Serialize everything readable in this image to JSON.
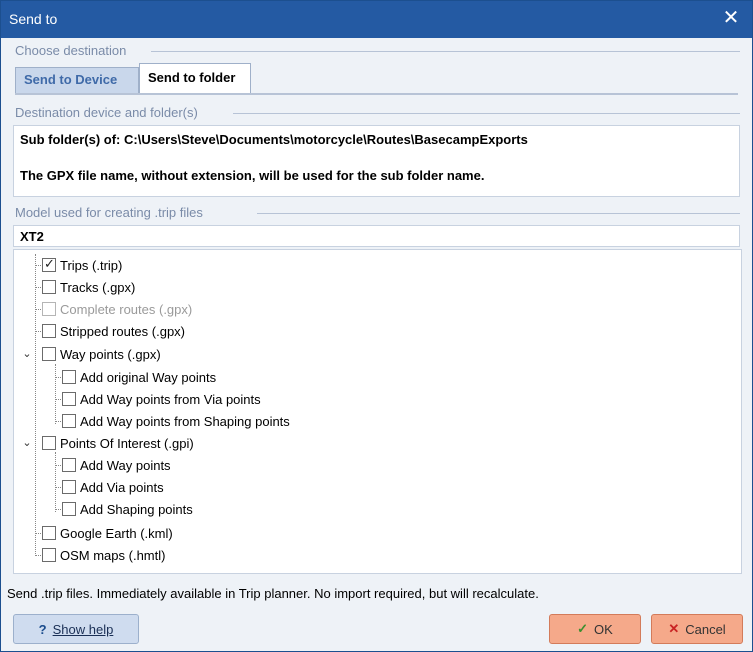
{
  "window": {
    "title": "Send to",
    "close_glyph": "✕"
  },
  "groups": {
    "choose_destination": "Choose destination",
    "destination_device": "Destination device and folder(s)",
    "model": "Model used for creating .trip files"
  },
  "tabs": [
    {
      "label": "Send to Device",
      "active": false
    },
    {
      "label": "Send to folder",
      "active": true
    }
  ],
  "destination": {
    "line1": "Sub folder(s) of: C:\\Users\\Steve\\Documents\\motorcycle\\Routes\\BasecampExports",
    "line2": "The GPX file name, without extension, will be used for the sub folder name."
  },
  "model_value": "XT2",
  "tree": {
    "trips": {
      "label": "Trips (.trip)",
      "checked": true
    },
    "tracks": {
      "label": "Tracks (.gpx)",
      "checked": false
    },
    "complete_routes": {
      "label": "Complete routes (.gpx)",
      "checked": false,
      "disabled": true
    },
    "stripped_routes": {
      "label": "Stripped routes (.gpx)",
      "checked": false
    },
    "way_points": {
      "label": "Way points (.gpx)",
      "checked": false,
      "expanded": true
    },
    "add_original_wp": {
      "label": "Add original Way points",
      "checked": false
    },
    "add_wp_from_via": {
      "label": "Add Way points from Via points",
      "checked": false
    },
    "add_wp_from_shaping": {
      "label": "Add Way points from Shaping points",
      "checked": false
    },
    "poi": {
      "label": "Points Of Interest (.gpi)",
      "checked": false,
      "expanded": true
    },
    "add_way_points": {
      "label": "Add Way points",
      "checked": false
    },
    "add_via_points": {
      "label": "Add Via points",
      "checked": false
    },
    "add_shaping_points": {
      "label": "Add Shaping points",
      "checked": false
    },
    "google_earth": {
      "label": "Google Earth (.kml)",
      "checked": false
    },
    "osm_maps": {
      "label": "OSM maps (.hmtl)",
      "checked": false
    }
  },
  "status": "Send .trip files. Immediately available in Trip planner. No import required, but will recalculate.",
  "buttons": {
    "help_icon": "?",
    "help": "Show help",
    "ok_icon": "✓",
    "ok": "OK",
    "cancel_icon": "✕",
    "cancel": "Cancel"
  },
  "icons": {
    "expander": "expanded-chevron-icon",
    "check": "check-icon"
  }
}
